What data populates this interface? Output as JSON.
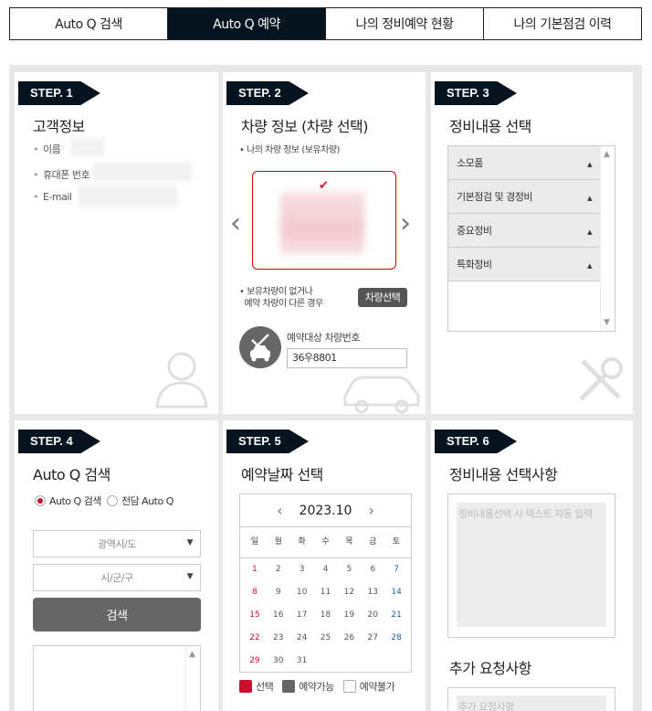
{
  "tabs": [
    {
      "label": "Auto Q 검색",
      "active": false
    },
    {
      "label": "Auto Q 예약",
      "active": true
    },
    {
      "label": "나의 정비예약 현황",
      "active": false
    },
    {
      "label": "나의 기본점검 이력",
      "active": false
    }
  ],
  "step1": {
    "badge": "STEP. 1",
    "title": "고객정보",
    "fields": [
      "이름",
      "휴대폰 번호",
      "E-mail"
    ]
  },
  "step2": {
    "badge": "STEP. 2",
    "title": "차량 정보 (차량 선택)",
    "owned_label": "나의 차량 정보 (보유차량)",
    "no_car_line1": "보유차량이 없거나",
    "no_car_line2": "예약 차량이 다른 경우",
    "select_car_button": "차량선택",
    "plate_label": "예약대상 차량번호",
    "plate_value": "36우8801"
  },
  "step3": {
    "badge": "STEP. 3",
    "title": "정비내용 선택",
    "items": [
      "소모품",
      "기본점검 및 경정비",
      "중요정비",
      "특화정비"
    ]
  },
  "step4": {
    "badge": "STEP. 4",
    "title": "Auto Q 검색",
    "radio1": "Auto Q 검색",
    "radio2": "전담 Auto Q",
    "select1": "광역시/도",
    "select2": "시/군/구",
    "search_button": "검색"
  },
  "step5": {
    "badge": "STEP. 5",
    "title": "예약날짜 선택",
    "month": "2023.10",
    "weekdays": [
      "일",
      "월",
      "화",
      "수",
      "목",
      "금",
      "토"
    ],
    "weeks": [
      [
        "1",
        "2",
        "3",
        "4",
        "5",
        "6",
        "7"
      ],
      [
        "8",
        "9",
        "10",
        "11",
        "12",
        "13",
        "14"
      ],
      [
        "15",
        "16",
        "17",
        "18",
        "19",
        "20",
        "21"
      ],
      [
        "22",
        "23",
        "24",
        "25",
        "26",
        "27",
        "28"
      ],
      [
        "29",
        "30",
        "31",
        "",
        "",
        "",
        ""
      ]
    ],
    "legend": {
      "selected": "선택",
      "available": "예약가능",
      "unavailable": "예약불가"
    },
    "colors": {
      "sunday": "#c8102e",
      "saturday": "#1f5fa6",
      "selected": "#c8102e",
      "available": "#666666"
    }
  },
  "step6": {
    "badge": "STEP. 6",
    "title": "정비내용 선택사항",
    "placeholder": "정비내용선택 시 텍스트 자동 입력",
    "extra_title": "추가 요청사항",
    "extra_placeholder": "추가 요청사항"
  }
}
